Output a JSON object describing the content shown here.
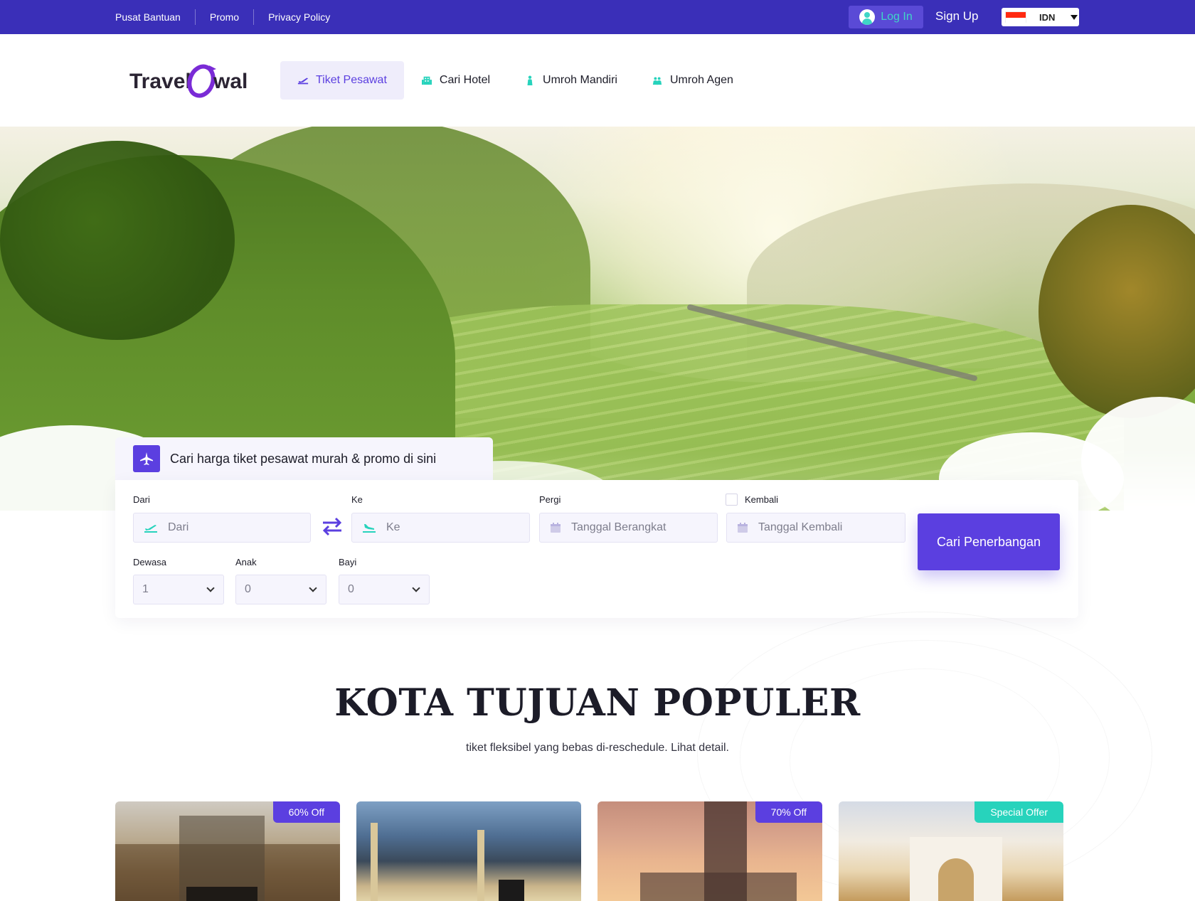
{
  "topbar": {
    "links": [
      "Pusat Bantuan",
      "Promo",
      "Privacy Policy"
    ],
    "login_label": "Log In",
    "signup_label": "Sign Up",
    "language": "IDN"
  },
  "brand": {
    "logo_text": "TravelAwal"
  },
  "nav": {
    "items": [
      {
        "label": "Tiket Pesawat",
        "icon": "plane-takeoff-icon",
        "active": true
      },
      {
        "label": "Cari Hotel",
        "icon": "hotel-icon",
        "active": false
      },
      {
        "label": "Umroh Mandiri",
        "icon": "person-icon",
        "active": false
      },
      {
        "label": "Umroh Agen",
        "icon": "group-icon",
        "active": false
      }
    ]
  },
  "search": {
    "tab_title": "Cari harga tiket pesawat murah & promo di sini",
    "from": {
      "label": "Dari",
      "placeholder": "Dari"
    },
    "to": {
      "label": "Ke",
      "placeholder": "Ke"
    },
    "depart": {
      "label": "Pergi",
      "placeholder": "Tanggal Berangkat"
    },
    "return": {
      "label": "Kembali",
      "placeholder": "Tanggal Kembali",
      "checked": false
    },
    "adults": {
      "label": "Dewasa",
      "value": "1"
    },
    "children": {
      "label": "Anak",
      "value": "0"
    },
    "infants": {
      "label": "Bayi",
      "value": "0"
    },
    "submit_label": "Cari Penerbangan"
  },
  "popular": {
    "title": "KOTA TUJUAN POPULER",
    "subtitle": "tiket fleksibel yang bebas di-reschedule. Lihat detail.",
    "cards": [
      {
        "badge": "60% Off",
        "badge_color": "#5b3fe0"
      },
      {
        "badge": "",
        "badge_color": ""
      },
      {
        "badge": "70% Off",
        "badge_color": "#5b3fe0"
      },
      {
        "badge": "Special Offer",
        "badge_color": "#27d3bc"
      }
    ]
  },
  "colors": {
    "primary": "#5b3fe0",
    "topbar": "#3a2fb8",
    "accent": "#27d3bc"
  }
}
